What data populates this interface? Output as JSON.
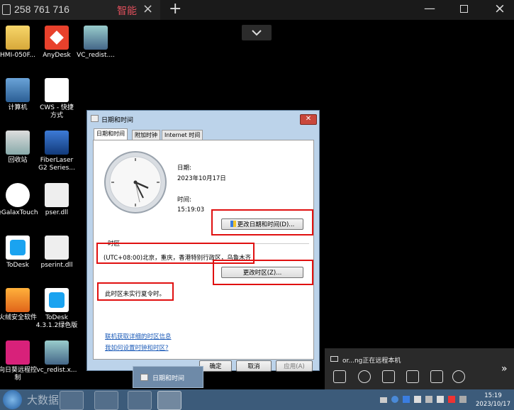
{
  "remote_bar": {
    "device_id": "258 761 716",
    "mode_label": "智能",
    "close_glyph": "×",
    "add_glyph": "+",
    "chevron_glyph": "⌄"
  },
  "desktop_icons": [
    {
      "label": "HMI-050F..."
    },
    {
      "label": "AnyDesk"
    },
    {
      "label": "VC_redist...."
    },
    {
      "label": "计算机"
    },
    {
      "label": "CWS - 快捷\n方式"
    },
    {
      "label": "回收站"
    },
    {
      "label": "FiberLaser\nG2 Series..."
    },
    {
      "label": "eGalaxTouch"
    },
    {
      "label": "pser.dll"
    },
    {
      "label": "ToDesk"
    },
    {
      "label": "pserint.dll"
    },
    {
      "label": "火绒安全软件"
    },
    {
      "label": "ToDesk\n4.3.1.2绿色版"
    },
    {
      "label": "向日葵远程控\n制"
    },
    {
      "label": "vc_redist.x..."
    }
  ],
  "dialog": {
    "title": "日期和时间",
    "tabs": [
      "日期和时间",
      "附加时钟",
      "Internet 时间"
    ],
    "date_label": "日期:",
    "date_value": "2023年10月17日",
    "time_label": "时间:",
    "time_value": "15:19:03",
    "change_datetime_button": "更改日期和时间(D)...",
    "timezone_section": "时区",
    "timezone_value": "(UTC+08:00)北京，重庆，香港特别行政区，乌鲁木齐",
    "change_timezone_button": "更改时区(Z)...",
    "dst_note": "此时区未实行夏令时。",
    "link_online": "联机获取详细的时区信息",
    "link_howto": "我如何设置时钟和时区?",
    "ok_button": "确定",
    "cancel_button": "取消",
    "apply_button": "应用(A)"
  },
  "taskbar": {
    "popup_label": "日期和时间",
    "watermark": "大数据",
    "clock_time": "15:19",
    "clock_date": "2023/10/17"
  },
  "remote_panel": {
    "status": "or...ng正在远程本机",
    "expand_glyph": "»"
  },
  "colors": {
    "highlight": "#e01010",
    "dialog_frame": "#bcd3ea",
    "taskbar": "#3c5b7a"
  }
}
